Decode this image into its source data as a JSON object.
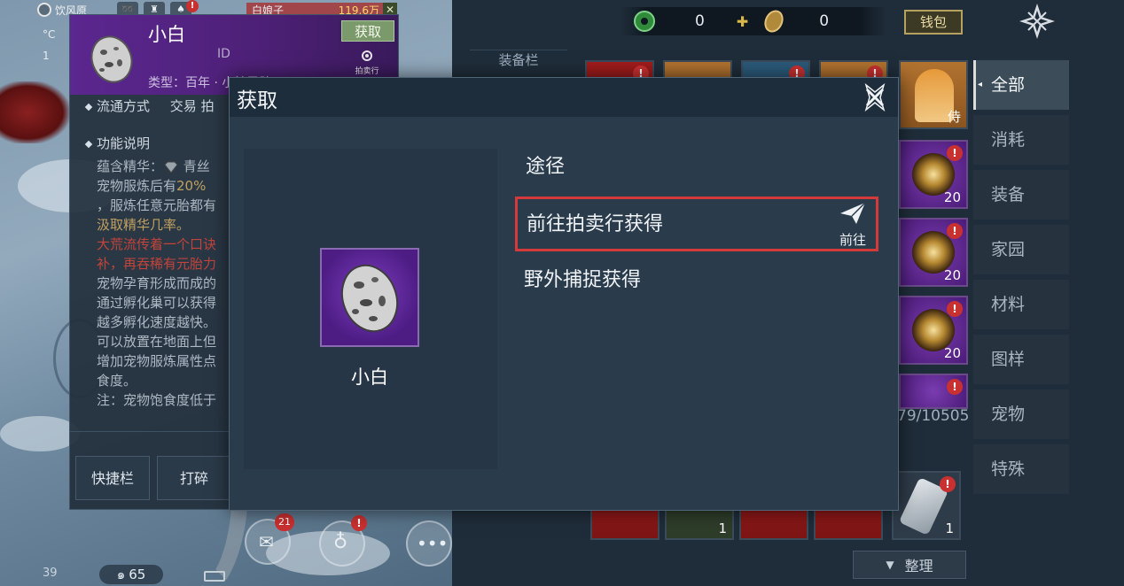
{
  "world": {
    "location": "饮风原",
    "coord_label": "1",
    "temp_label": "°C",
    "player_name": "白娘子",
    "player_value": "119.6万",
    "level": "39",
    "ping": "65"
  },
  "detail": {
    "item_name": "小白",
    "id_label": "ID",
    "obtain_label": "获取",
    "auction_label": "拍卖行",
    "type_text": "类型：百年 · 小精灵队",
    "tabs": [
      "流通方式",
      "交易 拍"
    ],
    "func_title": "功能说明",
    "func_lines": [
      {
        "text": "蕴含精华：",
        "tail": "青丝"
      },
      {
        "text": "宠物服炼后有",
        "hl": "20%",
        "tail": ""
      },
      {
        "text": "，服炼任意元胎都有",
        "hl": "",
        "tail": ""
      },
      {
        "text": "",
        "hl": "汲取精华几率。",
        "tail": ""
      },
      {
        "text": "",
        "red": "大荒流传着一个口诀"
      },
      {
        "text": "",
        "red": "补，再吞稀有元胎力"
      },
      {
        "text": "宠物孕育形成而成的"
      },
      {
        "text": "通过孵化巢可以获得"
      },
      {
        "text": "越多孵化速度越快。"
      },
      {
        "text": "可以放置在地面上但"
      },
      {
        "text": "增加宠物服炼属性点"
      },
      {
        "text": "食度。"
      },
      {
        "text": "注：宠物饱食度低于"
      }
    ],
    "buttons": [
      "快捷栏",
      "打碎"
    ]
  },
  "hud": {
    "mail_badge": "21",
    "excl": "!"
  },
  "inventory": {
    "currency_green": "0",
    "currency_gold": "0",
    "wallet_label": "钱包",
    "equip_title": "装备栏",
    "follower_label": "侍",
    "slot_counts": [
      "20",
      "20",
      "20"
    ],
    "bottom_counts": [
      "1",
      "1"
    ],
    "capacity": "79/10505",
    "sort_label": "整理",
    "categories": [
      "全部",
      "消耗",
      "装备",
      "家园",
      "材料",
      "图样",
      "宠物",
      "特殊"
    ]
  },
  "modal": {
    "title": "获取",
    "item_name": "小白",
    "route_title": "途径",
    "routes": [
      "前往拍卖行获得",
      "野外捕捉获得"
    ],
    "go_label": "前往"
  },
  "colors": {
    "accent_red": "#d43a3a",
    "item_purple": "#5b2790",
    "wallet_gold": "#b6a160"
  }
}
